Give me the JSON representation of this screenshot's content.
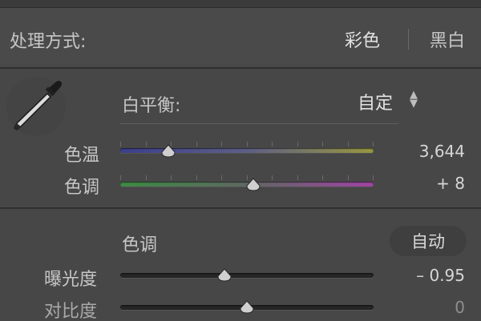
{
  "treatment": {
    "label": "处理方式:",
    "color_option": "彩色",
    "bw_option": "黑白"
  },
  "white_balance": {
    "label": "白平衡:",
    "selected": "自定",
    "eyedropper_icon": "eyedropper-icon",
    "stepper_icon": "up-down-arrows-icon",
    "sliders": [
      {
        "label": "色温",
        "value_text": "3,644",
        "position": 0.19
      },
      {
        "label": "色调",
        "value_text": "+ 8",
        "position": 0.525
      }
    ]
  },
  "tone": {
    "label": "色调",
    "auto_label": "自动",
    "sliders": [
      {
        "label": "曝光度",
        "value_text": "– 0.95",
        "position": 0.41
      },
      {
        "label": "对比度",
        "value_text": "0",
        "position": 0.5
      }
    ]
  },
  "colors": {
    "panel_bg": "#474747",
    "temp_start": "#3b3f8c",
    "temp_end": "#98963f",
    "tint_start": "#3c8a43",
    "tint_end": "#a043a4"
  }
}
